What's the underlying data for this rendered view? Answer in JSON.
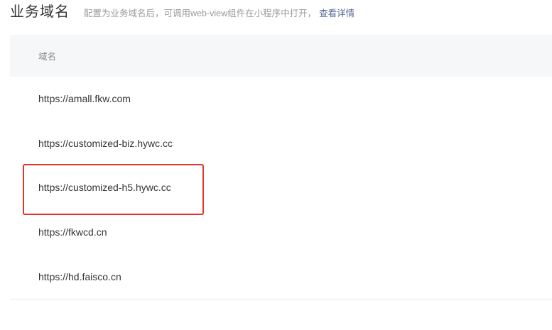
{
  "header": {
    "title": "业务域名",
    "description": "配置为业务域名后，可调用web-view组件在小程序中打开，",
    "link_label": "查看详情"
  },
  "table": {
    "column_header": "域名",
    "rows": [
      "https://amall.fkw.com",
      "https://customized-biz.hywc.cc",
      "https://customized-h5.hywc.cc",
      "https://fkwcd.cn",
      "https://hd.faisco.cn"
    ]
  },
  "annotation": {
    "highlight_color": "#e5332a",
    "highlighted_row": "https://customized-h5.hywc.cc"
  },
  "colors": {
    "link": "#576b95",
    "header_bg": "#f6f7f9",
    "text": "#353535",
    "muted": "#9a9a9a"
  }
}
